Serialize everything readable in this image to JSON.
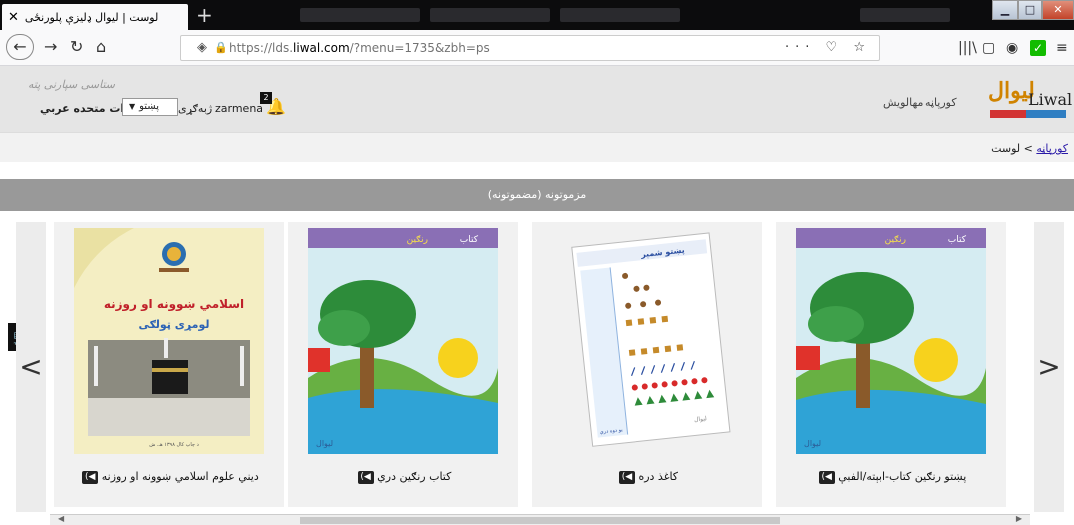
{
  "browser": {
    "tab_title": "لوست | لیوال ډلیزې پلورنځی",
    "tab_close": "✕",
    "new_tab": "+",
    "url_prefix": "https://lds.",
    "url_domain": "liwal.com",
    "url_suffix": "/?menu=1735&zbh=ps",
    "url_actions": "··· ♡ ☆",
    "win_min": "▁",
    "win_max": "□",
    "win_close": "✕"
  },
  "header": {
    "slogan": "ستاسی سپارنی پته",
    "country": "امارات متحده عربي",
    "language_label": "ژبه‌ګړی",
    "language_value": "پښتو",
    "username": "zarmena",
    "notification_count": "2",
    "nav": [
      "مهالویش",
      "کورپاڼه"
    ],
    "logo_ar": "لیوال",
    "logo_en": "Liwal"
  },
  "breadcrumb": {
    "home": "کورپاڼه",
    "sep": ">",
    "current": "لوست"
  },
  "section_title": "مزموتونه (مضموتونه)",
  "carousel": {
    "prev": "<",
    "next": ">",
    "items": [
      {
        "title": "دیني علوم اسلامي ښوونه او روزنه",
        "cover_heading": "اسلامي ښوونه او روزنه",
        "cover_sub": "لومړی ټولګی",
        "cover_note": "د چاپ کال ۱۳۹۸ هـ. ش"
      },
      {
        "title": "کتاب رنګين دري",
        "cover_heading": "کتاب",
        "cover_sub": "رنګین",
        "cover_note": "لیوال"
      },
      {
        "title": "کاغذ دره",
        "cover_heading": "پښتو شمېر",
        "cover_sub": "یو دوه درې",
        "cover_note": "لیوال"
      },
      {
        "title": "پښتو رنګین کتاب-ابېته/الفبې",
        "cover_heading": "کتاب",
        "cover_sub": "رنګین",
        "cover_note": "لیوال"
      }
    ]
  },
  "icons": {
    "cart": "🛒",
    "speaker": "◀))",
    "bell": "🔔"
  },
  "colors": {
    "section_bar": "#999999",
    "header_bg": "#e5e5e5",
    "link": "#2a1aa8",
    "logo_orange": "#d08300"
  }
}
